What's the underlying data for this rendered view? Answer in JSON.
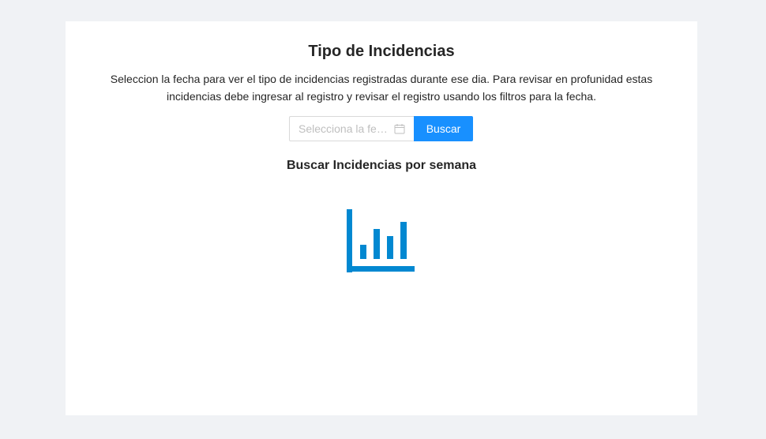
{
  "card": {
    "title": "Tipo de Incidencias",
    "description": "Seleccion la fecha para ver el tipo de incidencias registradas durante ese dia. Para revisar en profunidad estas incidencias debe ingresar al registro y revisar el registro usando los filtros para la fecha.",
    "date_picker": {
      "placeholder": "Selecciona la fe…",
      "icon": "calendar-icon"
    },
    "search_button_label": "Buscar",
    "subtitle": "Buscar Incidencias por semana",
    "empty_icon": "bar-chart-icon"
  },
  "colors": {
    "background": "#f0f2f5",
    "card": "#ffffff",
    "primary": "#1890ff",
    "icon": "#0288d1"
  }
}
